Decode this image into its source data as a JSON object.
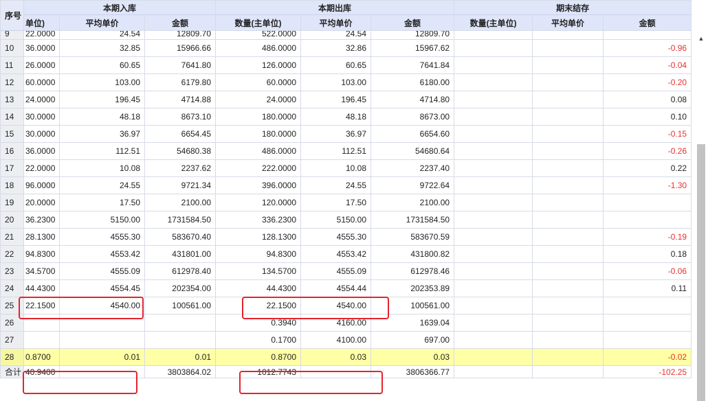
{
  "header": {
    "seq_label": "序号",
    "groups": {
      "in": "本期入库",
      "out": "本期出库",
      "end": "期末结存"
    },
    "columns": [
      "单位)",
      "平均单价",
      "金额",
      "数量(主单位)",
      "平均单价",
      "金额",
      "数量(主单位)",
      "平均单价",
      "金额"
    ]
  },
  "rows": [
    {
      "seq": "9",
      "c1": "22.0000",
      "c2": "24.54",
      "c3": "12809.70",
      "c4": "522.0000",
      "c5": "24.54",
      "c6": "12809.70",
      "c7": "",
      "c8": "",
      "c9": ""
    },
    {
      "seq": "10",
      "c1": "36.0000",
      "c2": "32.85",
      "c3": "15966.66",
      "c4": "486.0000",
      "c5": "32.86",
      "c6": "15967.62",
      "c7": "",
      "c8": "",
      "c9": "-0.96"
    },
    {
      "seq": "11",
      "c1": "26.0000",
      "c2": "60.65",
      "c3": "7641.80",
      "c4": "126.0000",
      "c5": "60.65",
      "c6": "7641.84",
      "c7": "",
      "c8": "",
      "c9": "-0.04"
    },
    {
      "seq": "12",
      "c1": "60.0000",
      "c2": "103.00",
      "c3": "6179.80",
      "c4": "60.0000",
      "c5": "103.00",
      "c6": "6180.00",
      "c7": "",
      "c8": "",
      "c9": "-0.20"
    },
    {
      "seq": "13",
      "c1": "24.0000",
      "c2": "196.45",
      "c3": "4714.88",
      "c4": "24.0000",
      "c5": "196.45",
      "c6": "4714.80",
      "c7": "",
      "c8": "",
      "c9": "0.08"
    },
    {
      "seq": "14",
      "c1": "30.0000",
      "c2": "48.18",
      "c3": "8673.10",
      "c4": "180.0000",
      "c5": "48.18",
      "c6": "8673.00",
      "c7": "",
      "c8": "",
      "c9": "0.10"
    },
    {
      "seq": "15",
      "c1": "30.0000",
      "c2": "36.97",
      "c3": "6654.45",
      "c4": "180.0000",
      "c5": "36.97",
      "c6": "6654.60",
      "c7": "",
      "c8": "",
      "c9": "-0.15"
    },
    {
      "seq": "16",
      "c1": "36.0000",
      "c2": "112.51",
      "c3": "54680.38",
      "c4": "486.0000",
      "c5": "112.51",
      "c6": "54680.64",
      "c7": "",
      "c8": "",
      "c9": "-0.26"
    },
    {
      "seq": "17",
      "c1": "22.0000",
      "c2": "10.08",
      "c3": "2237.62",
      "c4": "222.0000",
      "c5": "10.08",
      "c6": "2237.40",
      "c7": "",
      "c8": "",
      "c9": "0.22"
    },
    {
      "seq": "18",
      "c1": "96.0000",
      "c2": "24.55",
      "c3": "9721.34",
      "c4": "396.0000",
      "c5": "24.55",
      "c6": "9722.64",
      "c7": "",
      "c8": "",
      "c9": "-1.30"
    },
    {
      "seq": "19",
      "c1": "20.0000",
      "c2": "17.50",
      "c3": "2100.00",
      "c4": "120.0000",
      "c5": "17.50",
      "c6": "2100.00",
      "c7": "",
      "c8": "",
      "c9": ""
    },
    {
      "seq": "20",
      "c1": "36.2300",
      "c2": "5150.00",
      "c3": "1731584.50",
      "c4": "336.2300",
      "c5": "5150.00",
      "c6": "1731584.50",
      "c7": "",
      "c8": "",
      "c9": ""
    },
    {
      "seq": "21",
      "c1": "28.1300",
      "c2": "4555.30",
      "c3": "583670.40",
      "c4": "128.1300",
      "c5": "4555.30",
      "c6": "583670.59",
      "c7": "",
      "c8": "",
      "c9": "-0.19"
    },
    {
      "seq": "22",
      "c1": "94.8300",
      "c2": "4553.42",
      "c3": "431801.00",
      "c4": "94.8300",
      "c5": "4553.42",
      "c6": "431800.82",
      "c7": "",
      "c8": "",
      "c9": "0.18"
    },
    {
      "seq": "23",
      "c1": "34.5700",
      "c2": "4555.09",
      "c3": "612978.40",
      "c4": "134.5700",
      "c5": "4555.09",
      "c6": "612978.46",
      "c7": "",
      "c8": "",
      "c9": "-0.06"
    },
    {
      "seq": "24",
      "c1": "44.4300",
      "c2": "4554.45",
      "c3": "202354.00",
      "c4": "44.4300",
      "c5": "4554.44",
      "c6": "202353.89",
      "c7": "",
      "c8": "",
      "c9": "0.11"
    },
    {
      "seq": "25",
      "c1": "22.1500",
      "c2": "4540.00",
      "c3": "100561.00",
      "c4": "22.1500",
      "c5": "4540.00",
      "c6": "100561.00",
      "c7": "",
      "c8": "",
      "c9": ""
    },
    {
      "seq": "26",
      "c1": "",
      "c2": "",
      "c3": "",
      "c4": "0.3940",
      "c5": "4160.00",
      "c6": "1639.04",
      "c7": "",
      "c8": "",
      "c9": ""
    },
    {
      "seq": "27",
      "c1": "",
      "c2": "",
      "c3": "",
      "c4": "0.1700",
      "c5": "4100.00",
      "c6": "697.00",
      "c7": "",
      "c8": "",
      "c9": ""
    },
    {
      "seq": "28",
      "c1": "0.8700",
      "c2": "0.01",
      "c3": "0.01",
      "c4": "0.8700",
      "c5": "0.03",
      "c6": "0.03",
      "c7": "",
      "c8": "",
      "c9": "-0.02",
      "highlight": true
    },
    {
      "seq": "合计",
      "c1": "40.9400",
      "c2": "",
      "c3": "3803864.02",
      "c4": "1012.7743",
      "c5": "",
      "c6": "3806366.77",
      "c7": "",
      "c8": "",
      "c9": "-102.25",
      "partial": true
    }
  ],
  "colors": {
    "header_bg": "#dfe6fa",
    "highlight_row": "#ffffa6",
    "negative_text": "#e8322e",
    "annotation_box": "#e5232d"
  }
}
